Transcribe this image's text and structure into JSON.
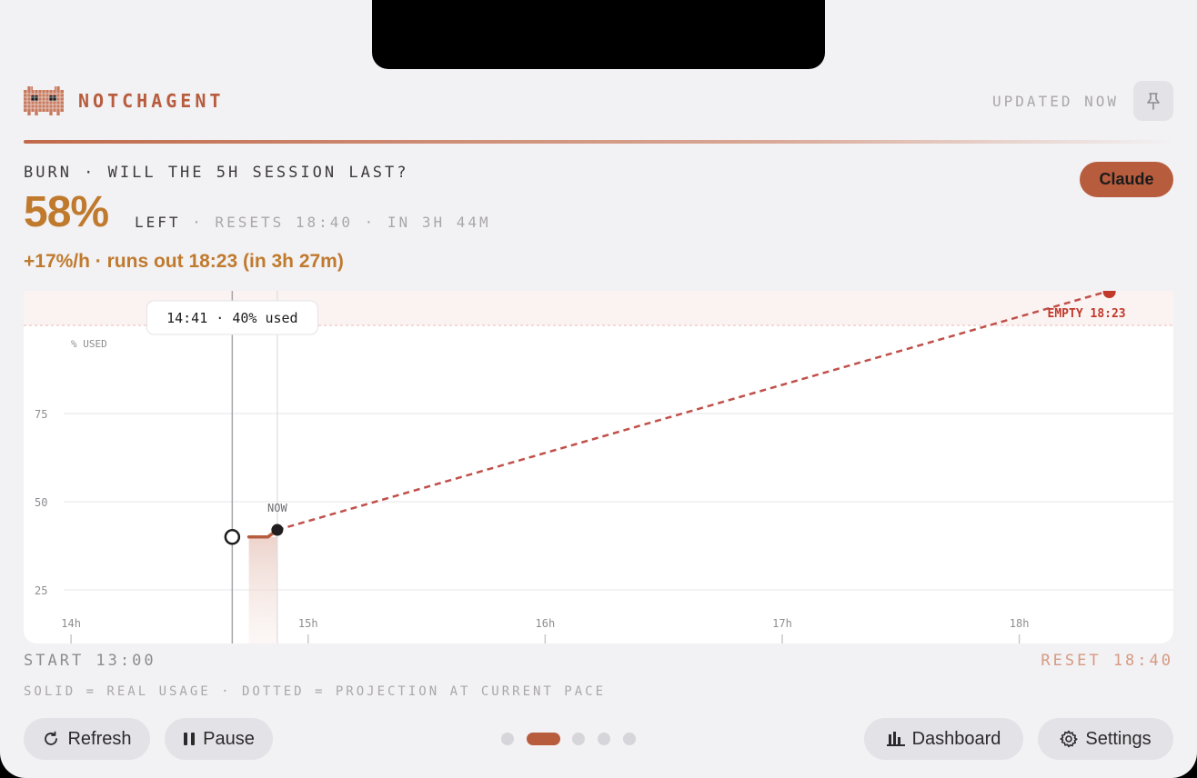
{
  "app": {
    "brand": "NOTCHAGENT",
    "updated": "UPDATED NOW",
    "icons": {
      "logo": "pixel-crab-logo",
      "pin": "pin-icon"
    }
  },
  "headline": {
    "question": "BURN · WILL THE 5H SESSION LAST?",
    "percent_left": "58%",
    "left_label": "LEFT",
    "resets": " · RESETS 18:40 · IN 3H 44M",
    "rate_line": "+17%/h · runs out 18:23 (in 3h 27m)",
    "provider_button": "Claude"
  },
  "chart_data": {
    "type": "line",
    "ylabel": "% USED",
    "ylim": [
      0,
      100
    ],
    "yticks": [
      25,
      50,
      75
    ],
    "x_domain_hours": [
      13.8,
      18.65
    ],
    "xticks": [
      {
        "label": "14h",
        "hour": 14
      },
      {
        "label": "15h",
        "hour": 15
      },
      {
        "label": "16h",
        "hour": 16
      },
      {
        "label": "17h",
        "hour": 17
      },
      {
        "label": "18h",
        "hour": 18
      }
    ],
    "series": [
      {
        "role": "actual",
        "points": [
          [
            14.75,
            40
          ],
          [
            14.83,
            40
          ],
          [
            14.87,
            42
          ]
        ]
      },
      {
        "role": "projection",
        "points": [
          [
            14.87,
            42
          ],
          [
            18.38,
            100
          ]
        ]
      }
    ],
    "now": {
      "label": "NOW",
      "hour": 14.87,
      "value": 42
    },
    "hover": {
      "tooltip": "14:41 · 40% used",
      "hour": 14.68,
      "value": 40
    },
    "empty": {
      "label": "EMPTY 18:23",
      "hour": 18.38,
      "value": 100
    },
    "threshold": 100,
    "colors": {
      "actual": "#b85c3e",
      "projection": "#c0504a",
      "empty": "#c0392b",
      "grid": "#e6e5e8",
      "tick": "#8e8c90"
    }
  },
  "footer": {
    "start": "START 13:00",
    "reset": "RESET 18:40",
    "legend": "SOLID = REAL USAGE · DOTTED = PROJECTION AT CURRENT PACE"
  },
  "actions": {
    "refresh": "Refresh",
    "pause": "Pause",
    "dashboard": "Dashboard",
    "settings": "Settings"
  },
  "pager": {
    "count": 5,
    "active": 1
  }
}
